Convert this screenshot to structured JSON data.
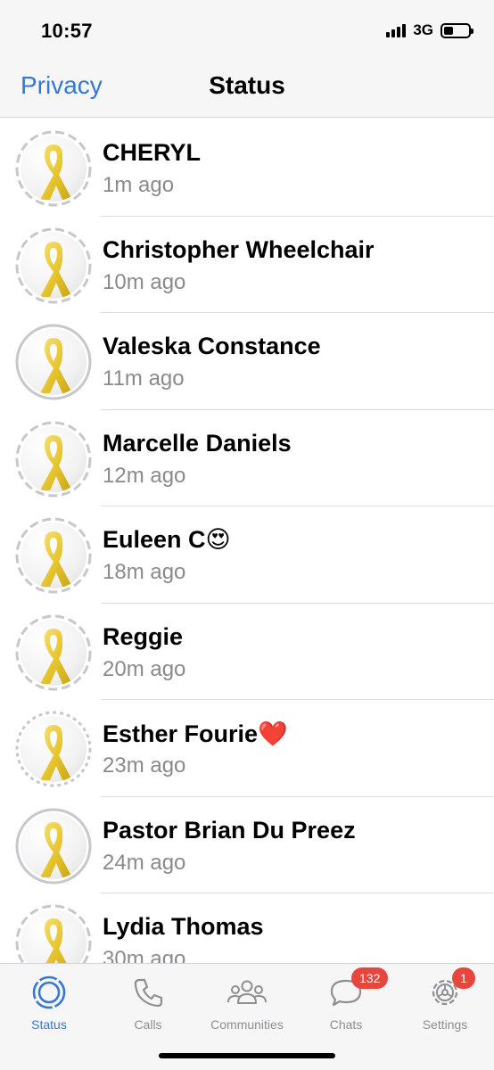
{
  "status_bar": {
    "time": "10:57",
    "network": "3G"
  },
  "nav": {
    "left_label": "Privacy",
    "title": "Status"
  },
  "statuses": [
    {
      "name": "CHERYL",
      "time": "1m ago",
      "ring": "dashed"
    },
    {
      "name": "Christopher Wheelchair",
      "time": "10m ago",
      "ring": "dashed"
    },
    {
      "name": "Valeska Constance",
      "time": "11m ago",
      "ring": "solid"
    },
    {
      "name": "Marcelle Daniels",
      "time": "12m ago",
      "ring": "dashed"
    },
    {
      "name": "Euleen C😍",
      "time": "18m ago",
      "ring": "dashed"
    },
    {
      "name": "Reggie",
      "time": "20m ago",
      "ring": "dashed"
    },
    {
      "name": "Esther Fourie❤️",
      "time": "23m ago",
      "ring": "dotted"
    },
    {
      "name": "Pastor Brian Du Preez",
      "time": "24m ago",
      "ring": "solid"
    },
    {
      "name": "Lydia Thomas",
      "time": "30m ago",
      "ring": "dashed"
    }
  ],
  "tabs": {
    "status": {
      "label": "Status",
      "icon": "status-ring-icon"
    },
    "calls": {
      "label": "Calls",
      "icon": "phone-icon"
    },
    "communities": {
      "label": "Communities",
      "icon": "people-group-icon"
    },
    "chats": {
      "label": "Chats",
      "icon": "chat-bubble-icon",
      "badge": "132"
    },
    "settings": {
      "label": "Settings",
      "icon": "gear-icon",
      "badge": "1"
    }
  },
  "colors": {
    "accent": "#3478d6",
    "badge": "#e8453c",
    "ribbon": "#e8c630",
    "muted": "#8a8a8e"
  }
}
